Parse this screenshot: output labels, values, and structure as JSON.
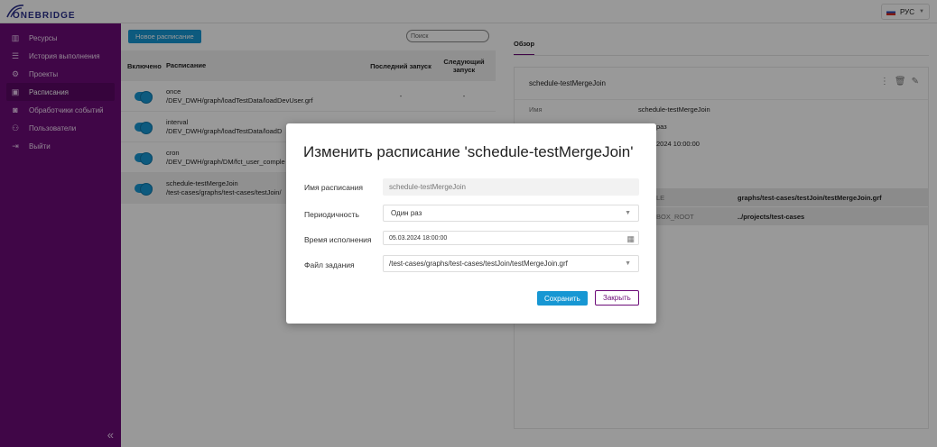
{
  "brand": {
    "logo_text": "ONEBRIDGE"
  },
  "lang": {
    "label": "РУС"
  },
  "sidebar": {
    "items": [
      {
        "label": "Ресурсы",
        "icon": "chart-icon"
      },
      {
        "label": "История выполнения",
        "icon": "list-icon"
      },
      {
        "label": "Проекты",
        "icon": "gear-icon"
      },
      {
        "label": "Расписания",
        "icon": "calendar-icon"
      },
      {
        "label": "Обработчики событий",
        "icon": "event-icon"
      },
      {
        "label": "Пользователи",
        "icon": "users-icon"
      },
      {
        "label": "Выйти",
        "icon": "logout-icon"
      }
    ],
    "active_index": 3
  },
  "toolbar": {
    "new_label": "Новое расписание",
    "search_placeholder": "Поиск"
  },
  "table": {
    "headers": [
      "Включено",
      "Расписание",
      "Последний запуск",
      "Следующий запуск"
    ],
    "rows": [
      {
        "name": "once",
        "path": "/DEV_DWH/graph/loadTestData/loadDevUser.grf",
        "last": "-",
        "next": "-"
      },
      {
        "name": "interval",
        "path": "/DEV_DWH/graph/loadTestData/loadD",
        "last": "",
        "next": ""
      },
      {
        "name": "cron",
        "path": "/DEV_DWH/graph/DM/fct_user_comple",
        "last": "",
        "next": ""
      },
      {
        "name": "schedule-testMergeJoin",
        "path": "/test-cases/graphs/test-cases/testJoin/",
        "last": "",
        "next": ""
      }
    ]
  },
  "detail": {
    "tab": "Обзор",
    "title": "schedule-testMergeJoin",
    "fields": [
      {
        "key": "Имя",
        "value": "schedule-testMergeJoin"
      },
      {
        "key": "",
        "value": "раз"
      },
      {
        "key": "",
        "value": "2024 10:00:00"
      }
    ],
    "band_rows": [
      {
        "key": "LE",
        "value": "graphs/test-cases/testJoin/testMergeJoin.grf"
      },
      {
        "key": "BOX_ROOT",
        "value": "../projects/test-cases"
      }
    ]
  },
  "modal": {
    "title": "Изменить расписание 'schedule-testMergeJoin'",
    "name_label": "Имя расписания",
    "name_value": "schedule-testMergeJoin",
    "period_label": "Периодичность",
    "period_value": "Один раз",
    "time_label": "Время исполнения",
    "time_value": "05.03.2024 18:00:00",
    "file_label": "Файл задания",
    "file_value": "/test-cases/graphs/test-cases/testJoin/testMergeJoin.grf",
    "save_label": "Сохранить",
    "close_label": "Закрыть"
  },
  "colors": {
    "sidebar": "#6b0a77",
    "accent": "#1797d3"
  }
}
